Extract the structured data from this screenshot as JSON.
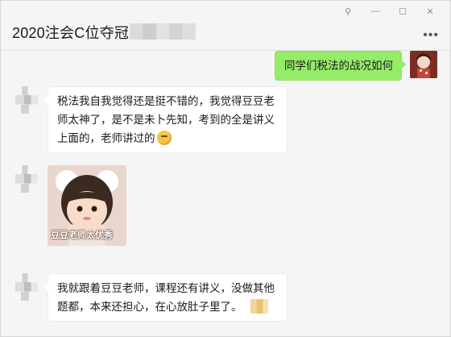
{
  "window": {
    "title": "2020注会C位夺冠",
    "controls": {
      "pin": "⚲",
      "minimize": "—",
      "maximize": "☐",
      "close": "✕"
    },
    "more": "•••"
  },
  "messages": [
    {
      "side": "right",
      "type": "text",
      "text": "同学们税法的战况如何"
    },
    {
      "side": "left",
      "type": "text",
      "lines": [
        "税法我自我觉得还是挺不错的，我觉得豆豆老",
        "师太神了，是不是未卜先知，考到的全是讲义",
        "上面的，老师讲过的"
      ],
      "emoji": "thinking-face-emoji"
    },
    {
      "side": "left",
      "type": "sticker",
      "caption": "豆豆老师太优秀"
    },
    {
      "side": "left",
      "type": "text",
      "lines": [
        "我就跟着豆豆老师，课程还有讲义，没做其他",
        "题都，本来还担心，在心放肚子里了。"
      ]
    }
  ],
  "colors": {
    "bubble_mine": "#95ec69",
    "bubble_other": "#ffffff",
    "background": "#f5f5f5"
  }
}
